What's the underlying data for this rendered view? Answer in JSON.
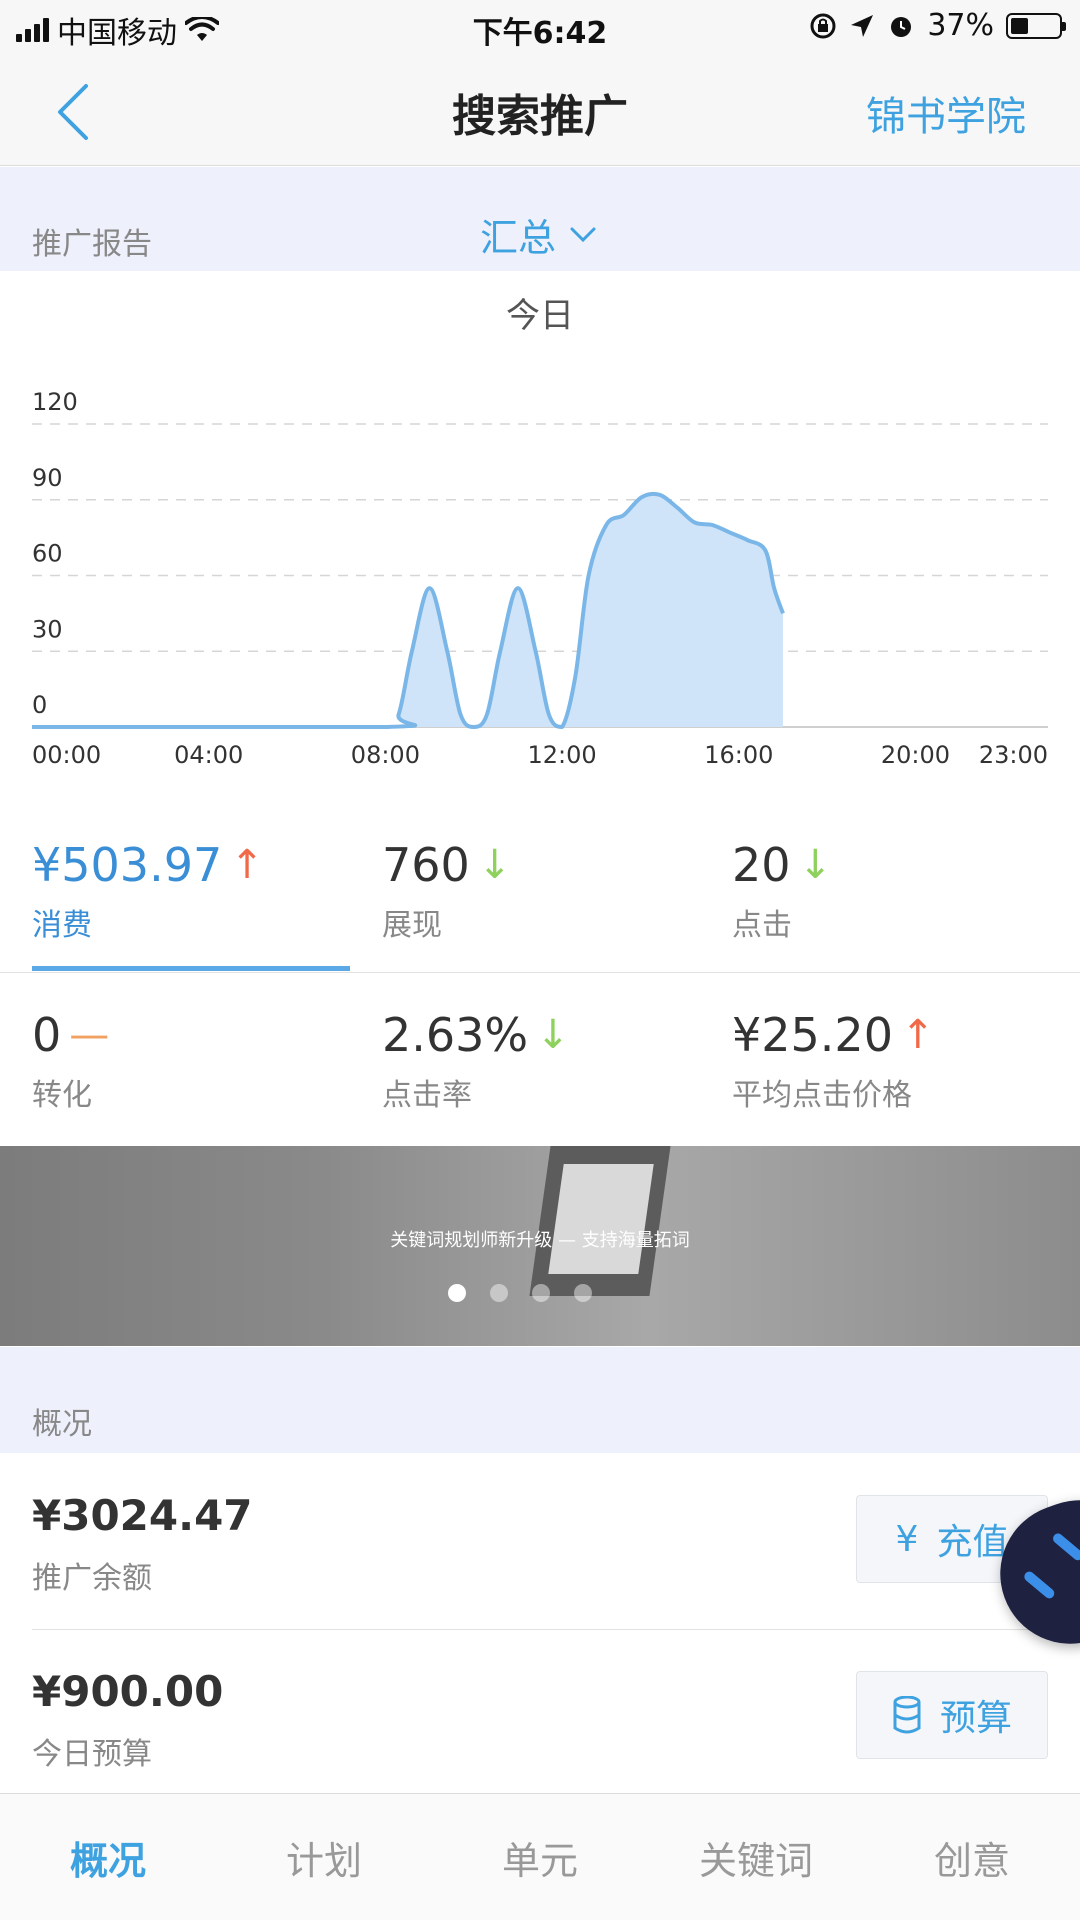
{
  "status_bar": {
    "carrier": "中国移动",
    "time": "下午6:42",
    "battery_percent": "37%",
    "battery_level": 0.37
  },
  "nav": {
    "title": "搜索推广",
    "right_link": "锦书学院"
  },
  "report": {
    "label": "推广报告",
    "selector": "汇总"
  },
  "chart_data": {
    "type": "area",
    "period": "今日",
    "x_tick_labels": [
      "00:00",
      "04:00",
      "08:00",
      "12:00",
      "16:00",
      "20:00",
      "23:00"
    ],
    "x_tick_hours": [
      0,
      4,
      8,
      12,
      16,
      20,
      23
    ],
    "y_tick_labels": [
      "120",
      "90",
      "60",
      "30",
      "0"
    ],
    "y_ticks": [
      120,
      90,
      60,
      30,
      0
    ],
    "ylim": [
      0,
      120
    ],
    "xlim": [
      0,
      23
    ],
    "grid": "dashed-horizontal",
    "color": "#7ab7e8",
    "fill_color": "#cfe4f8",
    "points": [
      {
        "x": 0,
        "y": 0
      },
      {
        "x": 8,
        "y": 0
      },
      {
        "x": 8.3,
        "y": 5
      },
      {
        "x": 8.6,
        "y": 30
      },
      {
        "x": 9,
        "y": 55
      },
      {
        "x": 9.4,
        "y": 30
      },
      {
        "x": 9.7,
        "y": 5
      },
      {
        "x": 10,
        "y": 0
      },
      {
        "x": 10.3,
        "y": 5
      },
      {
        "x": 10.6,
        "y": 30
      },
      {
        "x": 11,
        "y": 55
      },
      {
        "x": 11.4,
        "y": 30
      },
      {
        "x": 11.7,
        "y": 5
      },
      {
        "x": 12,
        "y": 0
      },
      {
        "x": 12.3,
        "y": 20
      },
      {
        "x": 12.6,
        "y": 60
      },
      {
        "x": 13,
        "y": 80
      },
      {
        "x": 13.4,
        "y": 84
      },
      {
        "x": 13.8,
        "y": 91
      },
      {
        "x": 14.2,
        "y": 92
      },
      {
        "x": 14.6,
        "y": 87
      },
      {
        "x": 15,
        "y": 81
      },
      {
        "x": 15.4,
        "y": 80
      },
      {
        "x": 15.8,
        "y": 77
      },
      {
        "x": 16.2,
        "y": 74
      },
      {
        "x": 16.6,
        "y": 70
      },
      {
        "x": 16.8,
        "y": 55
      },
      {
        "x": 17,
        "y": 45
      }
    ]
  },
  "metrics": [
    {
      "value": "¥503.97",
      "label": "消费",
      "trend": "up",
      "trend_symbol": "↑",
      "active": true
    },
    {
      "value": "760",
      "label": "展现",
      "trend": "down",
      "trend_symbol": "↓",
      "active": false
    },
    {
      "value": "20",
      "label": "点击",
      "trend": "down",
      "trend_symbol": "↓",
      "active": false
    },
    {
      "value": "0",
      "label": "转化",
      "trend": "flat",
      "trend_symbol": "—",
      "active": false
    },
    {
      "value": "2.63%",
      "label": "点击率",
      "trend": "down",
      "trend_symbol": "↓",
      "active": false
    },
    {
      "value": "¥25.20",
      "label": "平均点击价格",
      "trend": "up",
      "trend_symbol": "↑",
      "active": false
    }
  ],
  "banner": {
    "text": "关键词规划师新升级 — 支持海量拓词",
    "page_count": 4,
    "active_page": 1
  },
  "overview": {
    "label": "概况",
    "balance": {
      "amount": "¥3024.47",
      "label": "推广余额",
      "button": "充值",
      "icon": "yen-icon"
    },
    "budget": {
      "amount": "¥900.00",
      "label": "今日预算",
      "button": "预算",
      "icon": "database-icon"
    }
  },
  "tabs": [
    {
      "label": "概况",
      "active": true
    },
    {
      "label": "计划",
      "active": false
    },
    {
      "label": "单元",
      "active": false
    },
    {
      "label": "关键词",
      "active": false
    },
    {
      "label": "创意",
      "active": false
    }
  ],
  "colors": {
    "accent": "#3fa2e0",
    "trend_up": "#f06a4a",
    "trend_down": "#8ed15d",
    "trend_flat": "#f0a060"
  }
}
